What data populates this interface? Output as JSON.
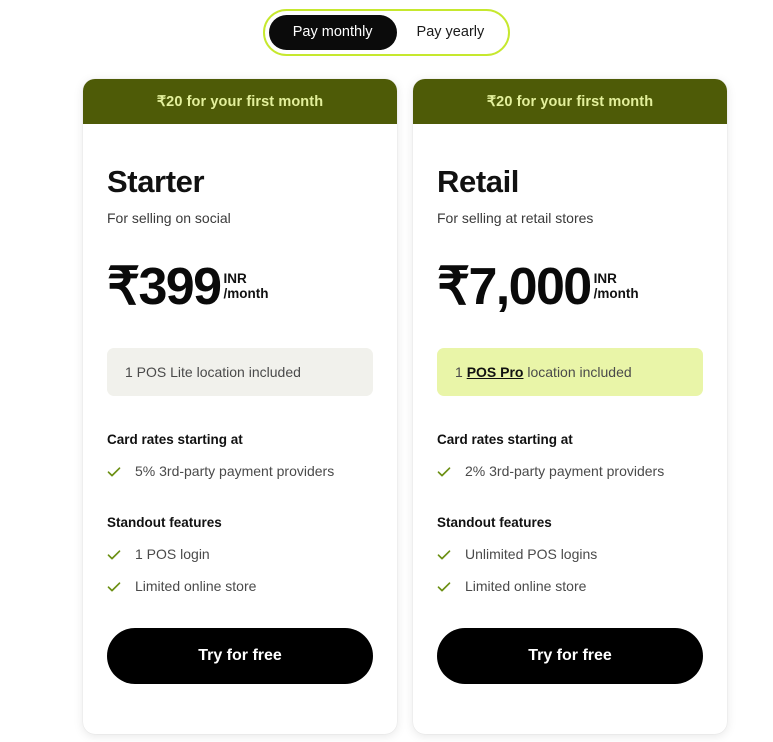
{
  "billing_toggle": {
    "name": "billing-period-toggle",
    "options": [
      {
        "label": "Pay monthly",
        "active": true
      },
      {
        "label": "Pay yearly",
        "active": false
      }
    ]
  },
  "theme": {
    "accent_border": "#c6e82e",
    "banner_bg": "#4e5b07",
    "banner_text": "#e3f09c",
    "highlight_bg": "#e9f5a8",
    "neutral_bg": "#f1f1ec",
    "check_color": "#6b8f12",
    "cta_bg": "#000000",
    "page_bg": "#ffffff"
  },
  "plans": [
    {
      "banner": "₹20 for your first month",
      "name": "Starter",
      "subtitle": "For selling on social",
      "price": "₹399",
      "currency": "INR",
      "period": "/month",
      "callout": {
        "prefix": "1 POS Lite location included",
        "strong": "",
        "suffix": "",
        "highlighted": false
      },
      "sections": [
        {
          "title": "Card rates starting at",
          "features": [
            "5% 3rd-party payment providers"
          ]
        },
        {
          "title": "Standout features",
          "features": [
            "1 POS login",
            "Limited online store"
          ]
        }
      ],
      "cta": "Try for free"
    },
    {
      "banner": "₹20 for your first month",
      "name": "Retail",
      "subtitle": "For selling at retail stores",
      "price": "₹7,000",
      "currency": "INR",
      "period": "/month",
      "callout": {
        "prefix": "1 ",
        "strong": "POS Pro",
        "suffix": " location included",
        "highlighted": true
      },
      "sections": [
        {
          "title": "Card rates starting at",
          "features": [
            "2% 3rd-party payment providers"
          ]
        },
        {
          "title": "Standout features",
          "features": [
            "Unlimited POS logins",
            "Limited online store"
          ]
        }
      ],
      "cta": "Try for free"
    }
  ]
}
